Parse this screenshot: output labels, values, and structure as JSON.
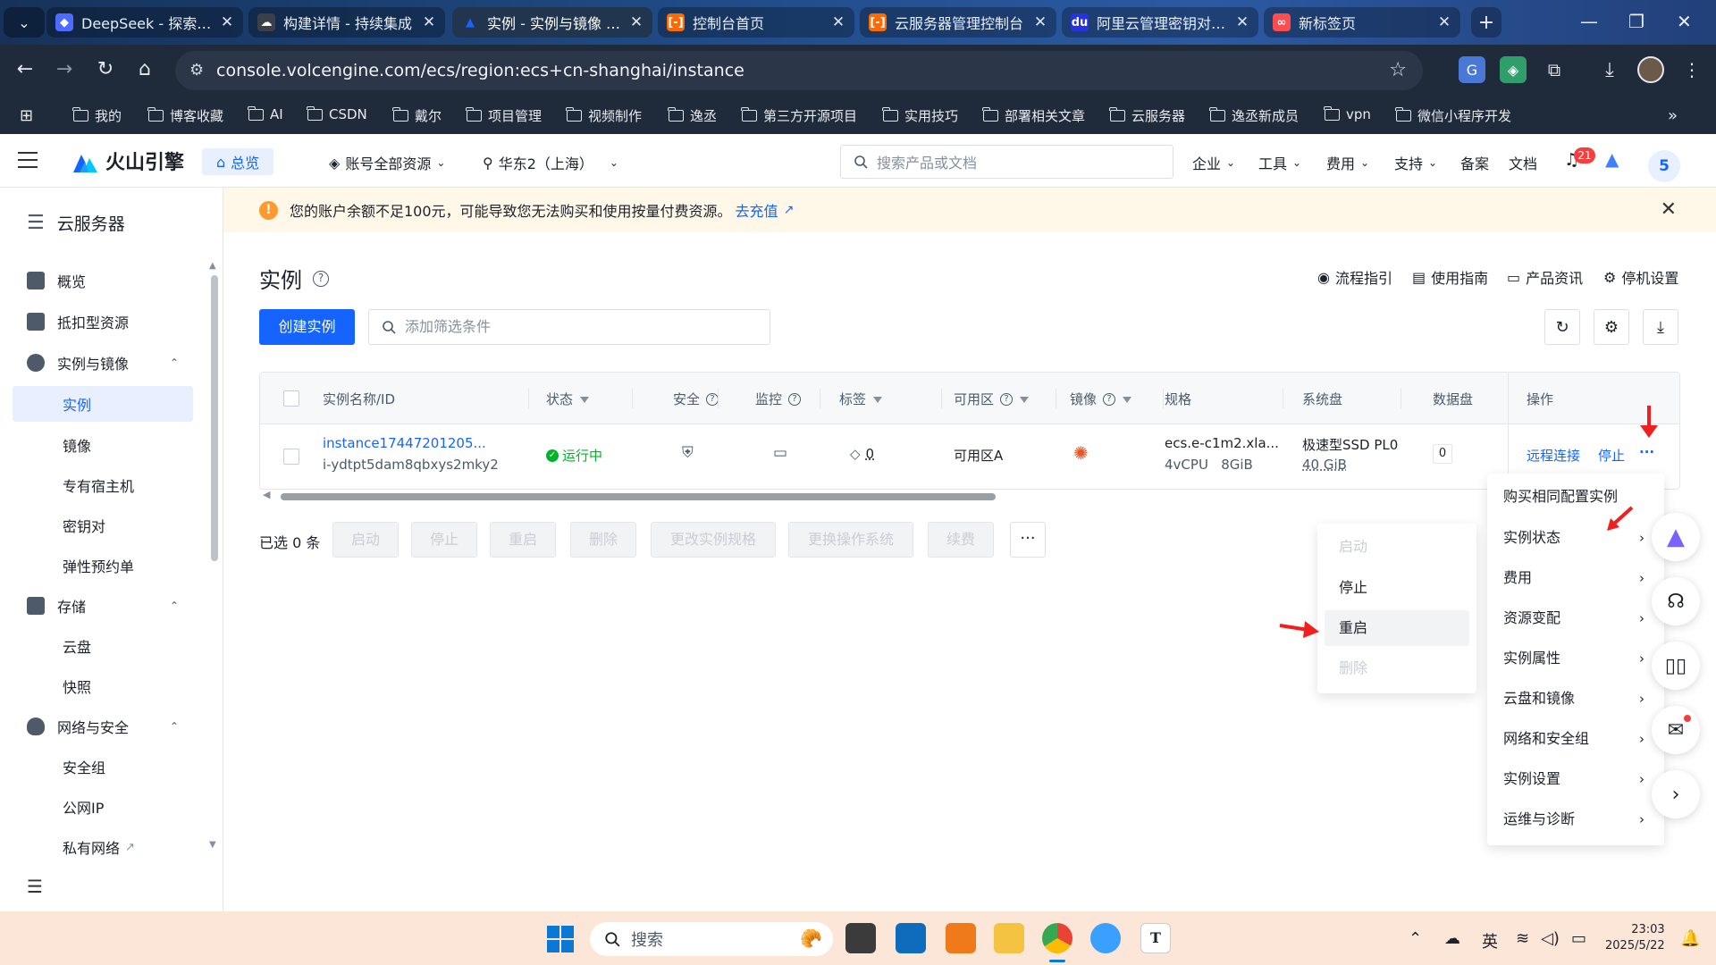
{
  "browser": {
    "tabs": [
      {
        "title": "DeepSeek - 探索未至",
        "icon": "deepseek-icon",
        "color": "#4d6bfe"
      },
      {
        "title": "构建详情 - 持续集成",
        "icon": "cloud-link-icon",
        "color": "#3a3f4a"
      },
      {
        "title": "实例 - 实例与镜像 - 云",
        "icon": "volcengine-icon",
        "color": "#1664ff"
      },
      {
        "title": "控制台首页",
        "icon": "aliyun-icon",
        "color": "#ff6a00"
      },
      {
        "title": "云服务器管理控制台",
        "icon": "aliyun-icon",
        "color": "#ff6a00"
      },
      {
        "title": "阿里云管理密钥对_云",
        "icon": "baidu-icon",
        "color": "#2932e1"
      },
      {
        "title": "新标签页",
        "icon": "chrome-newtab-icon",
        "color": "#ff4d4f"
      }
    ],
    "url": "console.volcengine.com/ecs/region:ecs+cn-shanghai/instance",
    "bookmarks": [
      "我的",
      "博客收藏",
      "AI",
      "CSDN",
      "戴尔",
      "项目管理",
      "视频制作",
      "逸丞",
      "第三方开源项目",
      "实用技巧",
      "部署相关文章",
      "云服务器",
      "逸丞新成员",
      "vpn",
      "微信小程序开发"
    ]
  },
  "header": {
    "logo": "火山引擎",
    "home": "总览",
    "account_scope": "账号全部资源",
    "region": "华东2（上海）",
    "search_placeholder": "搜索产品或文档",
    "menus": [
      "企业",
      "工具",
      "费用",
      "支持"
    ],
    "links": [
      "备案",
      "文档"
    ],
    "notification_count": "21",
    "user_initial": "5"
  },
  "sidebar": {
    "title": "云服务器",
    "items": [
      {
        "label": "概览",
        "type": "group"
      },
      {
        "label": "抵扣型资源",
        "type": "group"
      },
      {
        "label": "实例与镜像",
        "type": "group"
      },
      {
        "label": "实例",
        "type": "sub"
      },
      {
        "label": "镜像",
        "type": "sub"
      },
      {
        "label": "专有宿主机",
        "type": "sub"
      },
      {
        "label": "密钥对",
        "type": "sub"
      },
      {
        "label": "弹性预约单",
        "type": "sub"
      },
      {
        "label": "存储",
        "type": "group"
      },
      {
        "label": "云盘",
        "type": "sub"
      },
      {
        "label": "快照",
        "type": "sub"
      },
      {
        "label": "网络与安全",
        "type": "group"
      },
      {
        "label": "安全组",
        "type": "sub"
      },
      {
        "label": "公网IP",
        "type": "sub"
      },
      {
        "label": "私有网络",
        "type": "sub"
      }
    ]
  },
  "notice": {
    "text": "您的账户余额不足100元，可能导致您无法购买和使用按量付费资源。",
    "link": "去充值"
  },
  "page": {
    "title": "实例",
    "top_links": [
      "流程指引",
      "使用指南",
      "产品资讯",
      "停机设置"
    ],
    "create_button": "创建实例",
    "filter_placeholder": "添加筛选条件"
  },
  "table": {
    "headers": [
      "实例名称/ID",
      "状态",
      "安全",
      "监控",
      "标签",
      "可用区",
      "镜像",
      "规格",
      "系统盘",
      "数据盘",
      "操作"
    ],
    "row": {
      "name": "instance17447201205...",
      "id": "i-ydtpt5dam8qbxys2mky2",
      "status": "运行中",
      "status_color": "#00b42a",
      "tag_count": "0",
      "zone": "可用区A",
      "spec_line1": "ecs.e-c1m2.xla...",
      "spec_line2": "4vCPU   8GiB",
      "sysdisk_line1": "极速型SSD PL0",
      "sysdisk_line2": "40 GiB",
      "datadisk": "0",
      "ops": [
        "远程连接",
        "停止",
        "···"
      ]
    }
  },
  "bulk": {
    "selected": "已选 0 条",
    "buttons": [
      "启动",
      "停止",
      "重启",
      "删除",
      "更改实例规格",
      "更换操作系统",
      "续费"
    ],
    "more": "···"
  },
  "dropdown": {
    "items": [
      "购买相同配置实例",
      "实例状态",
      "费用",
      "资源变配",
      "实例属性",
      "云盘和镜像",
      "网络和安全组",
      "实例设置",
      "运维与诊断"
    ]
  },
  "submenu": {
    "items": [
      {
        "label": "启动",
        "disabled": true
      },
      {
        "label": "停止",
        "disabled": false
      },
      {
        "label": "重启",
        "disabled": false
      },
      {
        "label": "删除",
        "disabled": true
      }
    ]
  },
  "taskbar": {
    "search": "搜索",
    "ime": "英",
    "time": "23:03",
    "date": "2025/5/22"
  },
  "colors": {
    "primary": "#1664ff",
    "annotation_arrow": "#f02020",
    "warning": "#ff9a2e"
  }
}
